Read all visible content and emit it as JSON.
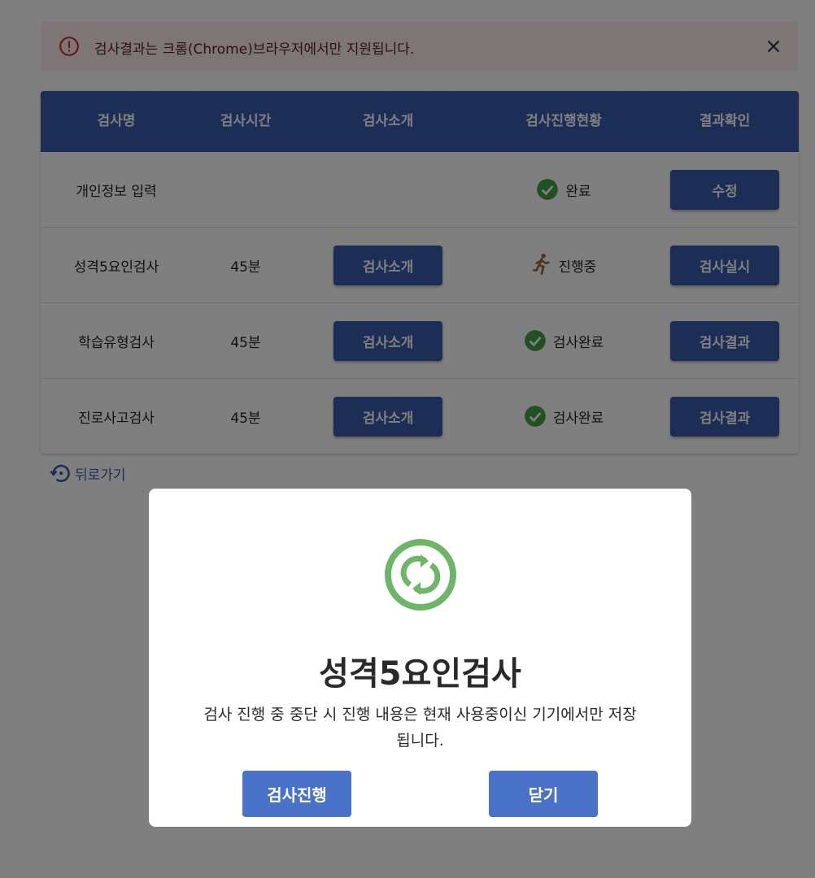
{
  "alert": {
    "message": "검사결과는 크롬(Chrome)브라우저에서만 지원됩니다.",
    "icon": "error-outline-icon",
    "close_icon": "close-icon"
  },
  "table": {
    "headers": [
      "검사명",
      "검사시간",
      "검사소개",
      "검사진행현황",
      "결과확인"
    ],
    "rows": [
      {
        "name": "개인정보 입력",
        "time": "",
        "intro": "",
        "status": "완료",
        "status_icon": "check-circle-icon",
        "action": "수정"
      },
      {
        "name": "성격5요인검사",
        "time": "45분",
        "intro": "검사소개",
        "status": "진행중",
        "status_icon": "running-person-icon",
        "action": "검사실시"
      },
      {
        "name": "학습유형검사",
        "time": "45분",
        "intro": "검사소개",
        "status": "검사완료",
        "status_icon": "check-circle-icon",
        "action": "검사결과"
      },
      {
        "name": "진로사고검사",
        "time": "45분",
        "intro": "검사소개",
        "status": "검사완료",
        "status_icon": "check-circle-icon",
        "action": "검사결과"
      }
    ]
  },
  "back_link": {
    "label": "뒤로가기",
    "icon": "history-icon"
  },
  "modal": {
    "icon": "sync-icon",
    "title": "성격5요인검사",
    "description": "검사 진행 중 중단 시 진행 내용은 현재 사용중이신 기기에서만 저장됩니다.",
    "proceed_label": "검사진행",
    "close_label": "닫기"
  },
  "colors": {
    "header_bg": "#3b5cad",
    "button_bg": "#3b5cad",
    "modal_button_bg": "#4a72c9",
    "success_green": "#43a047",
    "sync_green": "#6db567",
    "alert_bg": "#fdecec",
    "alert_icon": "#d32f2f"
  }
}
